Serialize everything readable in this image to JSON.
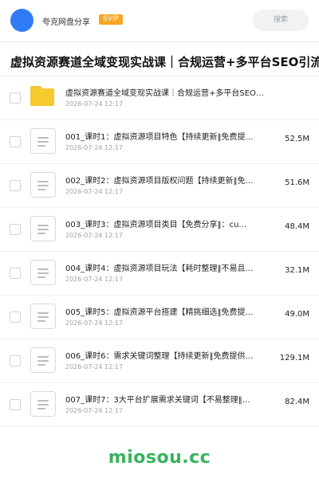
{
  "header": {
    "username": "夸克网盘分享",
    "badge": "SVIP",
    "search_placeholder": "搜索"
  },
  "page_title": "虚拟资源赛道全域变现实战课｜合规运营+多平台SEO引流+",
  "items": [
    {
      "type": "folder",
      "name": "虚拟资源赛道全域变现实战课｜合规运营+多平台SEO…",
      "date": "2026-07-24 12:17",
      "size": ""
    },
    {
      "type": "file",
      "name": "001_课时1：虚拟资源项目特色【持续更新‖免费提…",
      "date": "2026-07-24 12:17",
      "size": "52.5M"
    },
    {
      "type": "file",
      "name": "002_课时2：虚拟资源项目版权问题【持续更新‖免…",
      "date": "2026-07-24 12:17",
      "size": "51.6M"
    },
    {
      "type": "file",
      "name": "003_课时3：虚拟资源项目类目【免费分享‖：cu…",
      "date": "2026-07-24 12:17",
      "size": "48.4M"
    },
    {
      "type": "file",
      "name": "004_课时4：虚拟资源项目玩法【耗时整理‖不易且…",
      "date": "2026-07-24 12:17",
      "size": "32.1M"
    },
    {
      "type": "file",
      "name": "005_课时5：虚拟资源平台搭建【精挑细选‖免费提…",
      "date": "2026-07-24 12:17",
      "size": "49.0M"
    },
    {
      "type": "file",
      "name": "006_课时6：需求关键词整理【持续更新‖免费提供…",
      "date": "2026-07-24 12:17",
      "size": "129.1M"
    },
    {
      "type": "file",
      "name": "007_课时7：3大平台扩展需求关键词【不易整理‖…",
      "date": "2026-07-24 12:17",
      "size": "82.4M"
    }
  ],
  "watermark": "miosou.cc",
  "colors": {
    "accent": "#2f7cf6",
    "badge": "#f6a623",
    "folder": "#f6c92f",
    "watermark": "#35b45c"
  }
}
